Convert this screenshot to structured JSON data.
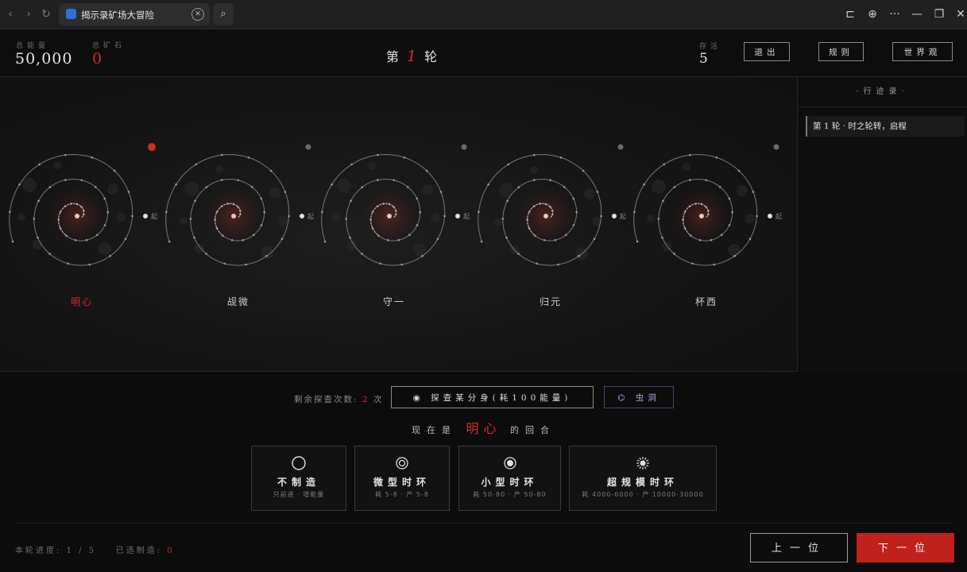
{
  "browser": {
    "tab_title": "揭示录矿场大冒险",
    "nav": {
      "back": "‹",
      "forward": "›",
      "refresh": "↻"
    },
    "close_tab": "✕",
    "search_glyph": "⌕",
    "window_icons": [
      "sidebar-icon",
      "globe-icon",
      "more-icon",
      "minimize-icon",
      "restore-icon",
      "close-icon"
    ],
    "window_glyphs": {
      "sidebar": "⊏",
      "globe": "⊕",
      "more": "···",
      "minimize": "—",
      "restore": "❐",
      "close": "✕"
    }
  },
  "header": {
    "energy_label": "总能量",
    "energy_value": "50,000",
    "ore_label": "总矿石",
    "ore_value": "0",
    "round_prefix": "第",
    "round_number": "1",
    "round_suffix": "轮",
    "alive_label": "存活",
    "alive_value": "5",
    "buttons": {
      "exit": "退出",
      "rules": "规则",
      "world": "世界观"
    }
  },
  "players": [
    {
      "name": "明心",
      "active": true,
      "end_label": "起"
    },
    {
      "name": "觇微",
      "active": false,
      "end_label": "起"
    },
    {
      "name": "守一",
      "active": false,
      "end_label": "起"
    },
    {
      "name": "归元",
      "active": false,
      "end_label": "起"
    },
    {
      "name": "杯西",
      "active": false,
      "end_label": "起"
    }
  ],
  "sidebar": {
    "title": "·行迹录·",
    "entries": [
      "第 1 轮 · 时之轮转，启程"
    ]
  },
  "actions": {
    "probe_label": "剩余探查次数:",
    "probe_count": "2",
    "probe_unit": "次",
    "probe_button_icon": "◉",
    "probe_button": "探查某分身(耗100能量)",
    "wormhole_icon": "⌬",
    "wormhole_button": "虫洞",
    "now_prefix": "现在是",
    "now_player": "明心",
    "now_suffix": "的回合"
  },
  "cards": [
    {
      "name": "不制造",
      "desc": "只前进 · 增能量",
      "icon": "circle-icon"
    },
    {
      "name": "微型时环",
      "desc": "耗 5-8 · 产 5-8",
      "icon": "double-circle-icon"
    },
    {
      "name": "小型时环",
      "desc": "耗 50-80 · 产 50-80",
      "icon": "dot-circle-icon"
    },
    {
      "name": "超规模时环",
      "desc": "耗 4000-6000 · 产 10000-30000",
      "icon": "sun-burst-icon"
    }
  ],
  "footer": {
    "progress_label": "本轮进度:",
    "progress_value": "1 / 5",
    "selected_label": "已选制造:",
    "selected_value": "0",
    "prev_button": "上一位",
    "next_button": "下一位"
  },
  "colors": {
    "accent": "#d32c26",
    "bg": "#0d0d0d",
    "panel": "#141414"
  }
}
